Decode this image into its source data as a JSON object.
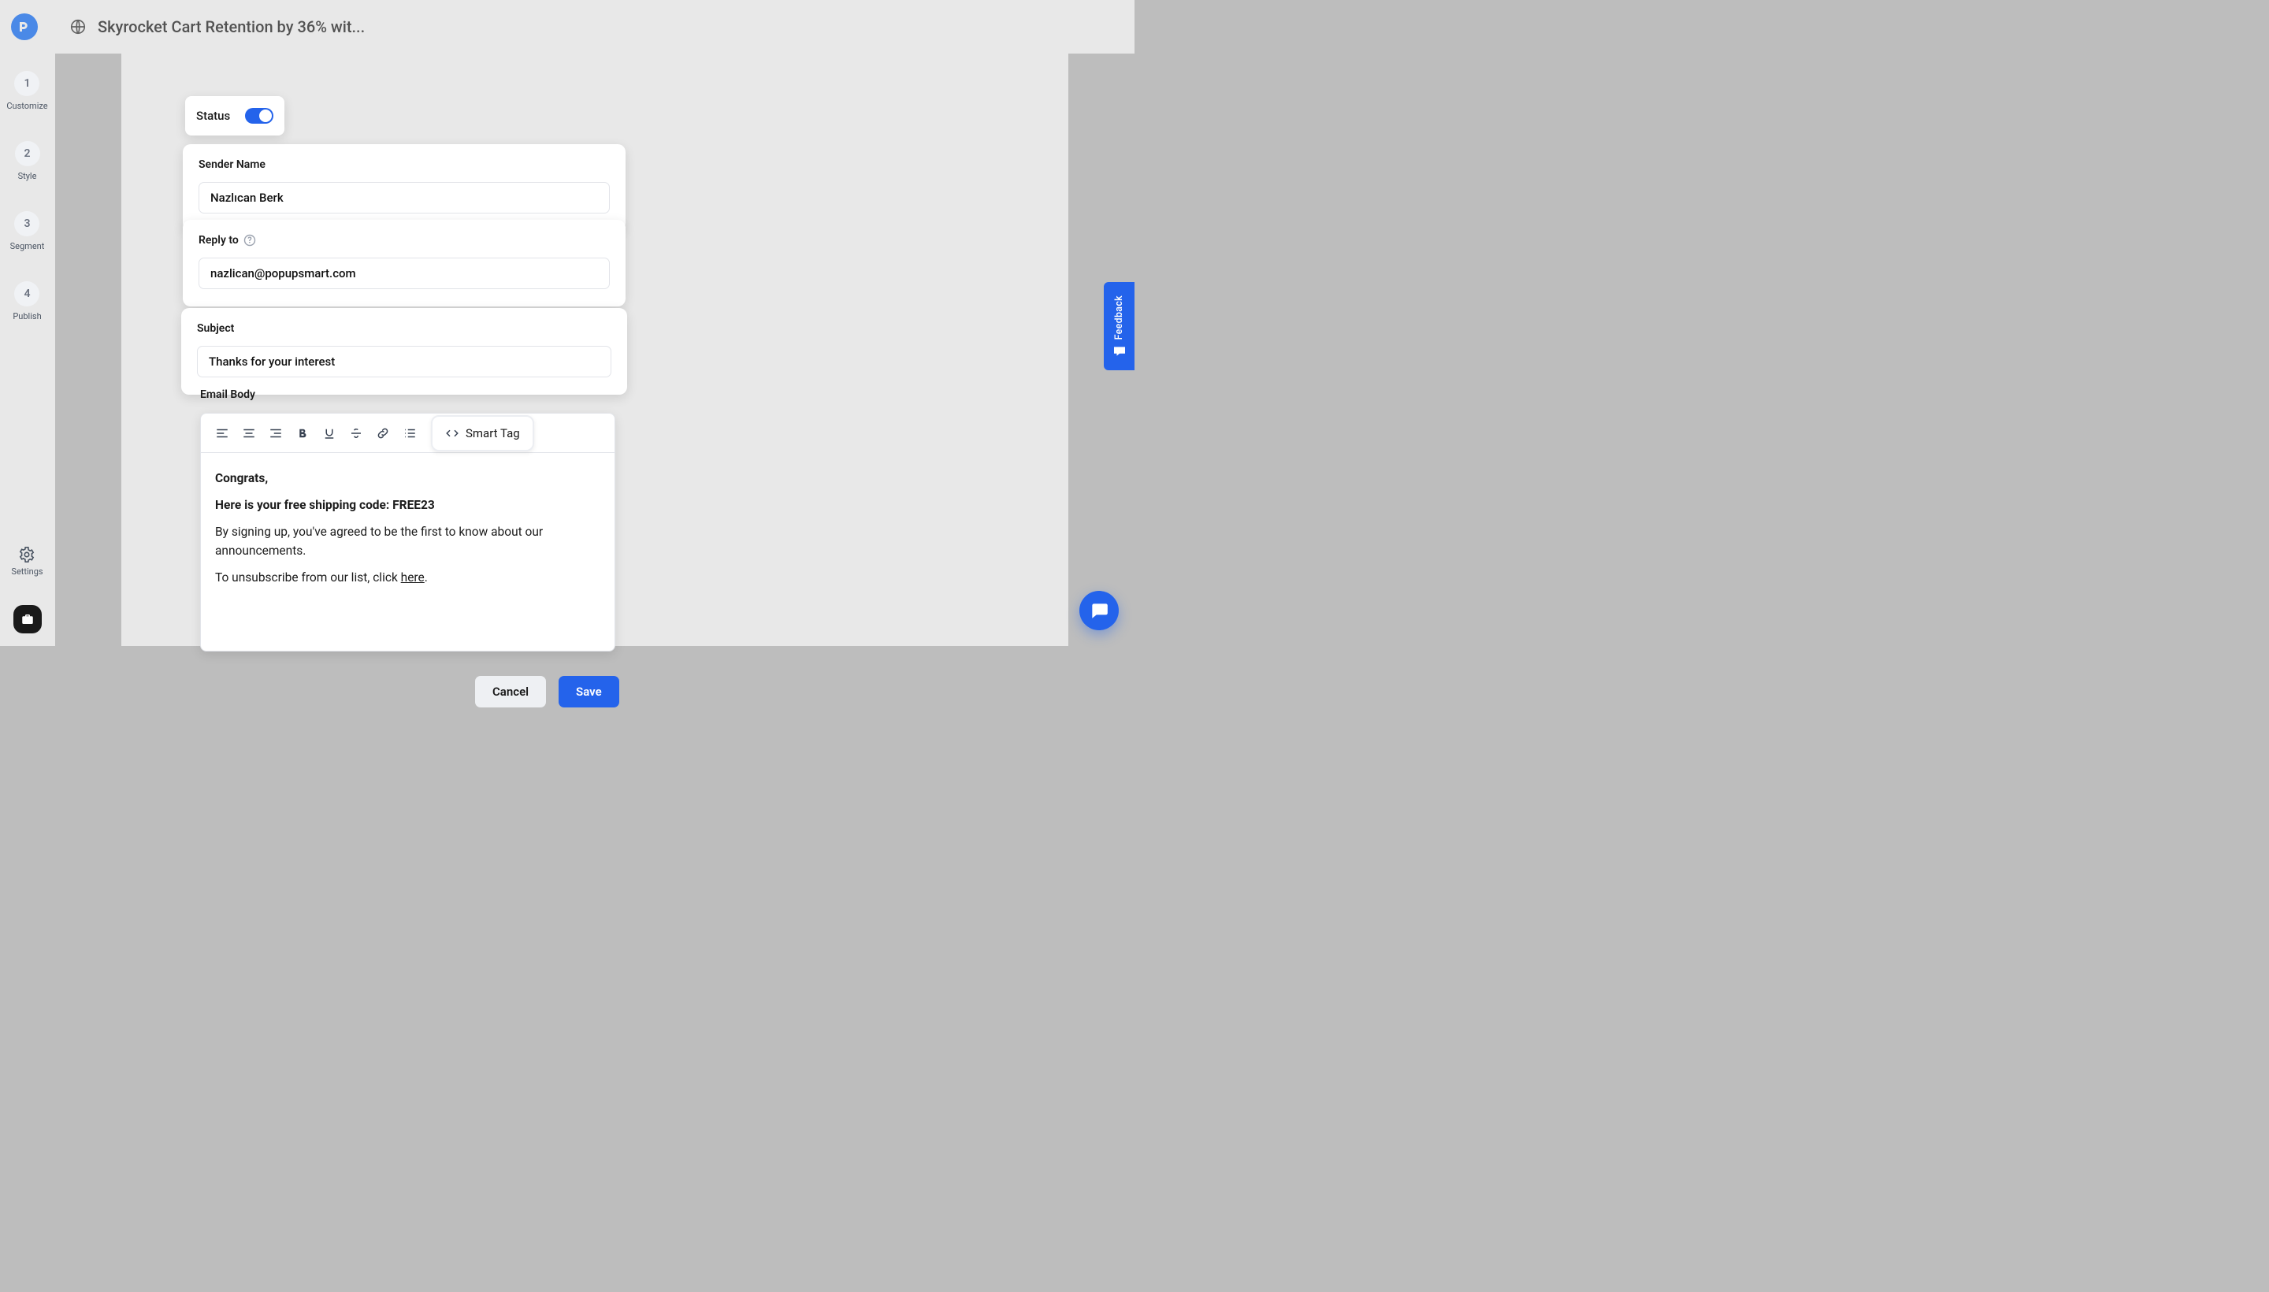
{
  "header": {
    "title": "Skyrocket Cart Retention by 36% wit..."
  },
  "sidebar": {
    "steps": [
      {
        "num": "1",
        "label": "Customize"
      },
      {
        "num": "2",
        "label": "Style"
      },
      {
        "num": "3",
        "label": "Segment"
      },
      {
        "num": "4",
        "label": "Publish"
      }
    ],
    "settings_label": "Settings"
  },
  "status": {
    "label": "Status",
    "on": true
  },
  "sender_name": {
    "label": "Sender Name",
    "value": "Nazlıcan Berk"
  },
  "reply_to": {
    "label": "Reply to",
    "value": "nazlican@popupsmart.com"
  },
  "subject": {
    "label": "Subject",
    "value": "Thanks for your interest"
  },
  "email_body": {
    "label": "Email Body",
    "toolbar": {
      "smart_tag": "Smart Tag"
    },
    "content": {
      "line1": "Congrats,",
      "line2": "Here is your free shipping code: FREE23",
      "line3": "By signing up, you've agreed to be the first to know about our announcements.",
      "line4_pre": "To unsubscribe from our list, click ",
      "line4_link": "here",
      "line4_post": "."
    }
  },
  "buttons": {
    "cancel": "Cancel",
    "save": "Save"
  },
  "feedback": {
    "label": "Feedback"
  },
  "colors": {
    "accent": "#2463eb"
  }
}
